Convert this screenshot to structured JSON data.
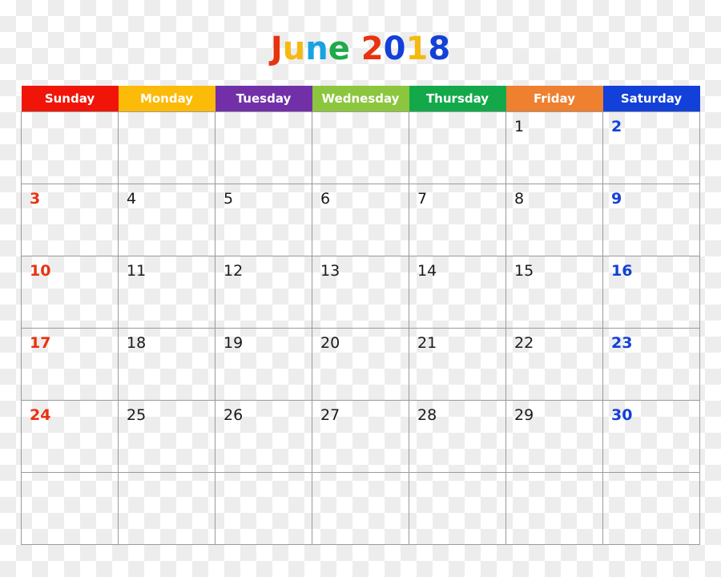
{
  "title": {
    "text": "June 2018",
    "letters": [
      {
        "ch": "J",
        "color": "#e8330f"
      },
      {
        "ch": "u",
        "color": "#f5b913"
      },
      {
        "ch": "n",
        "color": "#17a3e0"
      },
      {
        "ch": "e",
        "color": "#1fa94a"
      },
      {
        "ch": " ",
        "color": "#000000"
      },
      {
        "ch": "2",
        "color": "#e8330f"
      },
      {
        "ch": "0",
        "color": "#1340d8"
      },
      {
        "ch": "1",
        "color": "#f5b913"
      },
      {
        "ch": "8",
        "color": "#1340d8"
      }
    ]
  },
  "weekdays": [
    {
      "label": "Sunday",
      "bg": "#f01508",
      "text": "#ffffff"
    },
    {
      "label": "Monday",
      "bg": "#fcba09",
      "text": "#ffffff"
    },
    {
      "label": "Tuesday",
      "bg": "#7230a8",
      "text": "#ffffff"
    },
    {
      "label": "Wednesday",
      "bg": "#8cc63e",
      "text": "#ffffff"
    },
    {
      "label": "Thursday",
      "bg": "#13a94a",
      "text": "#ffffff"
    },
    {
      "label": "Friday",
      "bg": "#ee8030",
      "text": "#ffffff"
    },
    {
      "label": "Saturday",
      "bg": "#1340d8",
      "text": "#ffffff"
    }
  ],
  "colors": {
    "sunday_date": "#e8330f",
    "saturday_date": "#1340d8",
    "weekday_date": "#1a1a1a",
    "grid_line": "#9a9a9a",
    "checker_light": "#ffffff",
    "checker_dark": "#ededed"
  },
  "weeks": [
    [
      "",
      "",
      "",
      "",
      "",
      "1",
      "2"
    ],
    [
      "3",
      "4",
      "5",
      "6",
      "7",
      "8",
      "9"
    ],
    [
      "10",
      "11",
      "12",
      "13",
      "14",
      "15",
      "16"
    ],
    [
      "17",
      "18",
      "19",
      "20",
      "21",
      "22",
      "23"
    ],
    [
      "24",
      "25",
      "26",
      "27",
      "28",
      "29",
      "30"
    ],
    [
      "",
      "",
      "",
      "",
      "",
      "",
      ""
    ]
  ]
}
